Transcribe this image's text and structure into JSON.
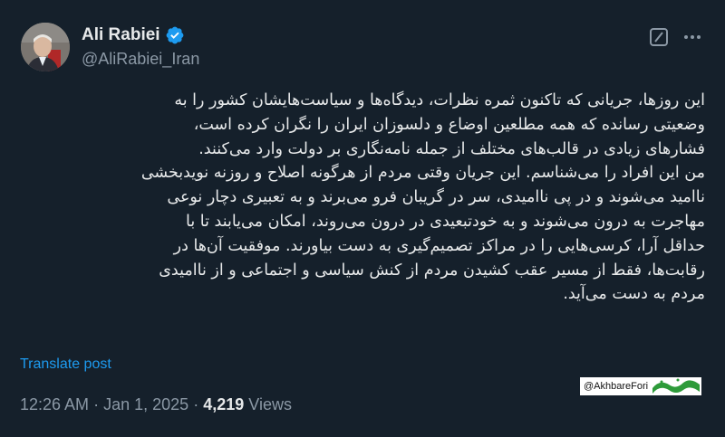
{
  "author": {
    "name": "Ali Rabiei",
    "handle": "@AliRabiei_Iran"
  },
  "icons": {
    "verified": "verified-badge-icon",
    "grok": "grok-icon",
    "more": "more-options-icon"
  },
  "post": {
    "text": "این روزها، جریانی که تاکنون ثمره نظرات، دیدگاه‌ها و سیاست‌هایشان کشور را به\nوضعیتی رسانده که همه مطلعین اوضاع و دلسوزان ایران را نگران کرده است،\nفشارهای زیادی در قالب‌های مختلف از جمله نامه‌نگاری بر دولت وارد می‌کنند.\nمن این افراد را می‌شناسم. این جریان وقتی مردم از هرگونه اصلاح و روزنه نویدبخشی\nناامید می‌شوند و در پی ناامیدی، سر در گریبان فرو می‌برند و به تعبیری دچار نوعی\nمهاجرت به درون می‌شوند و به خودتبعیدی در درون می‌روند، امکان می‌یابند تا با\nحداقل آرا، کرسی‌هایی را در مراکز تصمیم‌گیری به دست بیاورند. موفقیت آن‌ها در\nرقابت‌ها، فقط از مسیر عقب کشیدن مردم از کنش سیاسی و اجتماعی و از ناامیدی\nمردم به دست می‌آید.",
    "translate_label": "Translate post",
    "time": "12:26 AM",
    "date": "Jan 1, 2025",
    "separator": "·",
    "views_count": "4,219",
    "views_label": "Views"
  },
  "watermark": {
    "handle": "@AkhbareFori",
    "logo_text": "خبر فوری"
  },
  "colors": {
    "background": "#15202b",
    "text": "#e7e9ea",
    "secondary": "#8b98a5",
    "accent": "#1d9bf0",
    "logo_green": "#2e9b3a"
  }
}
